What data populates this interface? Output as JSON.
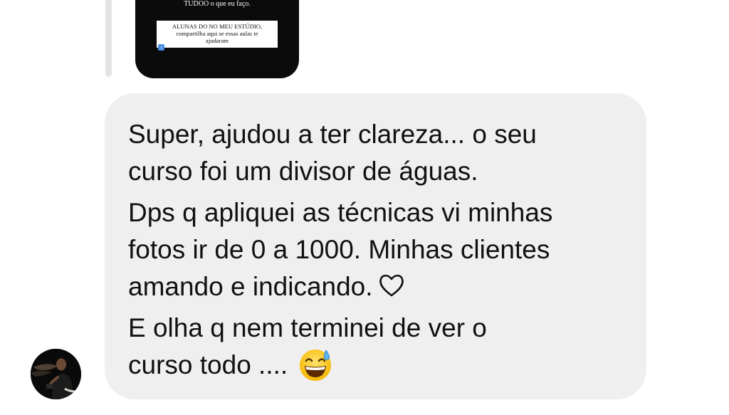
{
  "reply_preview": {
    "story_line1": "TUDOO o que eu faço.",
    "story_box_lines": [
      "ALUNAS DO NO MEU ESTÚDIO,",
      "compartilha aqui se essas aulas te",
      "ajudaram"
    ],
    "arrow_icon": "down-arrow-emoji-icon"
  },
  "message": {
    "paragraph1": [
      "Super, ajudou a ter  clareza... o seu",
      "curso foi um divisor de águas."
    ],
    "paragraph2": [
      "Dps q apliquei as técnicas vi minhas",
      "fotos ir de 0 a 1000. Minhas clientes",
      "amando e indicando."
    ],
    "heart_icon": "white-heart-icon",
    "paragraph3": [
      "E olha q nem terminei de ver o",
      "curso todo ...."
    ],
    "emoji_icon": "grinning-sweat-emoji-icon"
  },
  "colors": {
    "bubble_bg": "#efefef",
    "text": "#111111",
    "story_bg": "#0b0b0c"
  }
}
